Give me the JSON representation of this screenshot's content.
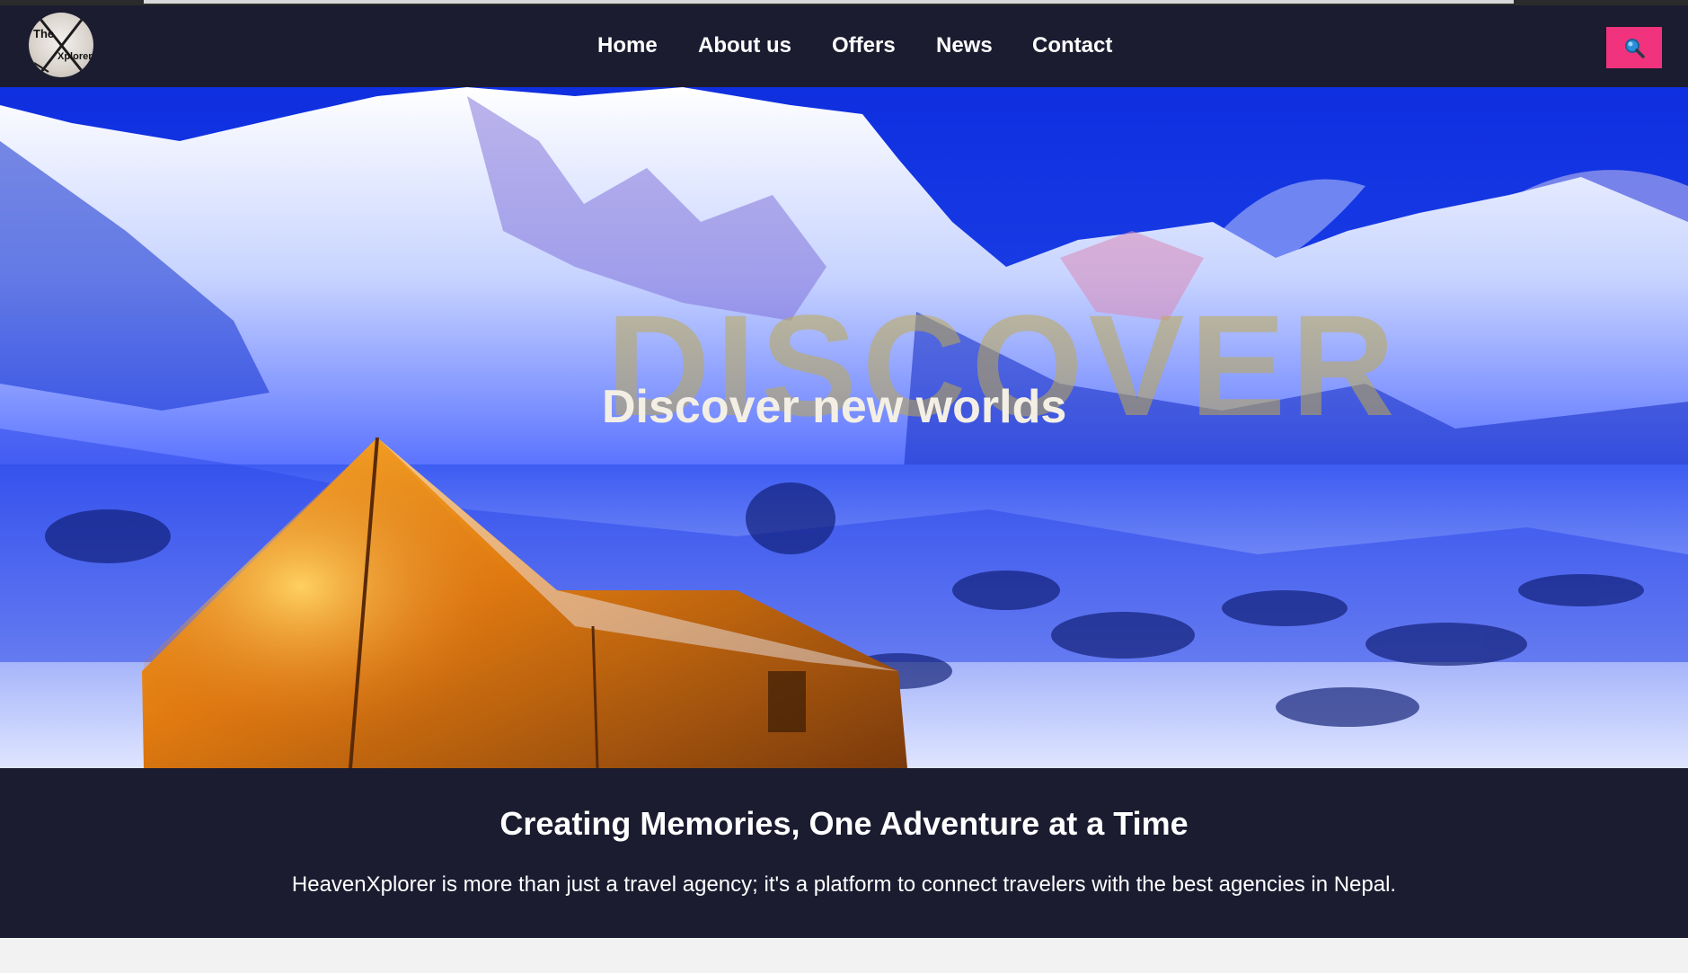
{
  "brand": {
    "logo_line1": "The",
    "logo_line2": "Xplorer"
  },
  "nav": {
    "items": [
      {
        "label": "Home"
      },
      {
        "label": "About us"
      },
      {
        "label": "Offers"
      },
      {
        "label": "News"
      },
      {
        "label": "Contact"
      }
    ],
    "search_icon": "search-icon",
    "search_color": "#f0337c"
  },
  "hero": {
    "ghost_text": "DISCOVER",
    "title": "Discover new worlds"
  },
  "about": {
    "title": "Creating Memories, One Adventure at a Time",
    "text": "HeavenXplorer is more than just a travel agency; it's a platform to connect travelers with the best agencies in Nepal."
  },
  "colors": {
    "nav_background": "#1b1c30",
    "accent": "#f0337c"
  }
}
